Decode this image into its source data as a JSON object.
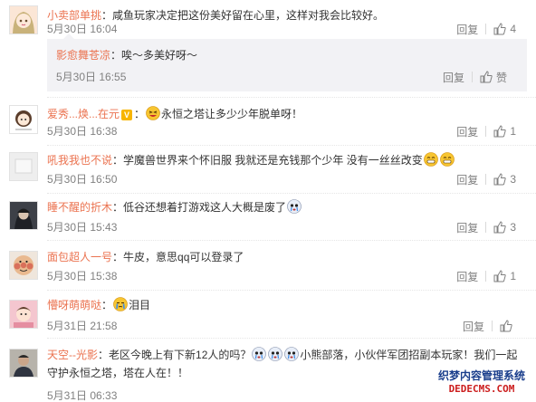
{
  "labels": {
    "reply": "回复",
    "praise": "赞"
  },
  "comments": [
    {
      "user": "小卖部单挑",
      "sep": "：",
      "text": "咸鱼玩家决定把这份美好留在心里，这样对我会比较好。",
      "time": "5月30日 16:04",
      "likes": "4",
      "avatar_icon": "anime-girl-avatar-icon",
      "reply": {
        "user": "影愈舞苍凉",
        "sep": "：",
        "text": "唉～多美好呀～",
        "time": "5月30日 16:55",
        "likes": "赞"
      }
    },
    {
      "user": "爱秀...焕...在元",
      "vip": "V",
      "sep": "：",
      "text": "永恒之塔让多少少年脱单呀！",
      "time": "5月30日 16:38",
      "likes": "1",
      "avatar_icon": "cartoon-girl-avatar-icon",
      "emoji_icon": "laughing-face-emoji-icon"
    },
    {
      "user": "吼我我也不说",
      "sep": "：",
      "text": "学魔兽世界来个怀旧服 我就还是充钱那个少年 没有一丝丝改变",
      "time": "5月30日 16:50",
      "likes": "3",
      "avatar_icon": "grey-blank-avatar-icon",
      "emoji_icon": "grinning-face-emoji-icon"
    },
    {
      "user": "睡不醒的折木",
      "sep": "：",
      "text": "低谷还想着打游戏这人大概是废了",
      "time": "5月30日 15:43",
      "likes": "3",
      "avatar_icon": "dark-character-avatar-icon",
      "emoji_icon": "crying-face-emoji-icon"
    },
    {
      "user": "面包超人一号",
      "sep": "：",
      "text": "牛皮，意思qq可以登录了",
      "time": "5月30日 15:38",
      "likes": "1",
      "avatar_icon": "anpanman-avatar-icon"
    },
    {
      "user": "懵呀萌萌哒",
      "sep": "：",
      "text": "泪目",
      "time": "5月31日 21:58",
      "likes": "",
      "avatar_icon": "pink-child-avatar-icon",
      "emoji_icon": "tears-emoji-icon"
    },
    {
      "user": "天空--光影",
      "sep": "：",
      "text_a": "老区今晚上有下新12人的吗？",
      "text_b": "小熊部落，小伙伴军团招副本玩家！我们一起守护永恒之塔，塔在人在！！",
      "time": "5月31日 06:33",
      "avatar_icon": "person-photo-avatar-icon",
      "emoji_icon": "crying-face-emoji-icon"
    }
  ],
  "watermark": {
    "line1": "织梦内容管理系统",
    "line2": "DEDECMS.COM"
  }
}
